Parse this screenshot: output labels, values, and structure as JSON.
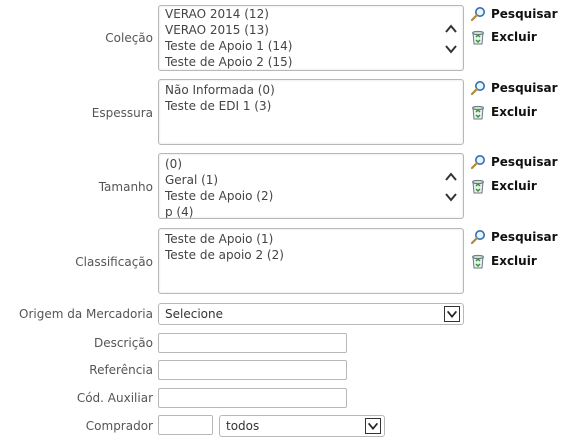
{
  "actions": {
    "search_label": "Pesquisar",
    "delete_label": "Excluir"
  },
  "colecao": {
    "label": "Coleção",
    "items": [
      "VERAO 2014 (12)",
      "VERAO 2015 (13)",
      "Teste de Apoio 1 (14)",
      "Teste de Apoio 2 (15)"
    ]
  },
  "espessura": {
    "label": "Espessura",
    "items": [
      "Não Informada (0)",
      "Teste de EDI 1 (3)"
    ]
  },
  "tamanho": {
    "label": "Tamanho",
    "items": [
      "(0)",
      "Geral (1)",
      "Teste de Apoio (2)",
      "p (4)"
    ]
  },
  "classificacao": {
    "label": "Classificação",
    "items": [
      "Teste de Apoio (1)",
      "Teste de apoio 2 (2)"
    ]
  },
  "origem": {
    "label": "Origem da Mercadoria",
    "selected": "Selecione"
  },
  "descricao": {
    "label": "Descrição",
    "value": ""
  },
  "referencia": {
    "label": "Referência",
    "value": ""
  },
  "cod_auxiliar": {
    "label": "Cód. Auxiliar",
    "value": ""
  },
  "comprador": {
    "label": "Comprador",
    "value": "",
    "selected": "todos"
  }
}
